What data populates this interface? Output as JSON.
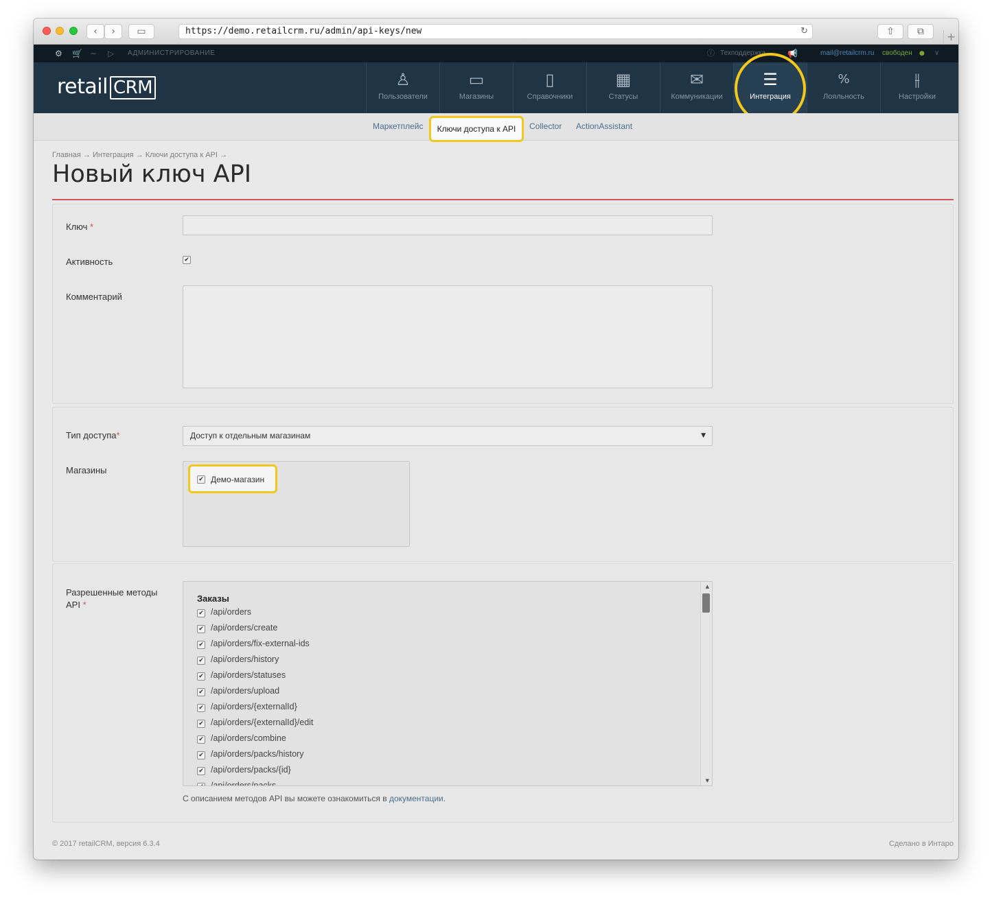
{
  "browser": {
    "url": "https://demo.retailcrm.ru/admin/api-keys/new",
    "new_tab": "+"
  },
  "adminbar": {
    "section": "АДМИНИСТРИРОВАНИЕ",
    "support": "Техподдержка",
    "email": "mail@retailcrm.ru",
    "status": "свободен"
  },
  "header": {
    "logo_text": "retail",
    "logo_crm": "CRM",
    "nav": [
      {
        "label": "Пользователи",
        "icon": "user-icon"
      },
      {
        "label": "Магазины",
        "icon": "shop-icon"
      },
      {
        "label": "Справочники",
        "icon": "document-icon"
      },
      {
        "label": "Статусы",
        "icon": "statuses-icon"
      },
      {
        "label": "Коммуникации",
        "icon": "mail-icon"
      },
      {
        "label": "Интеграция",
        "icon": "integration-icon",
        "active": true
      },
      {
        "label": "Лояльность",
        "icon": "discount-icon"
      },
      {
        "label": "Настройки",
        "icon": "sliders-icon"
      }
    ]
  },
  "subnav": {
    "items": [
      "Маркетплейс",
      "Ключи доступа к API",
      "Collector",
      "ActionAssistant"
    ],
    "active": "Ключи доступа к API"
  },
  "breadcrumb": "Главная → Интеграция → Ключи доступа к API →",
  "page_title": "Новый ключ API",
  "form": {
    "key_label": "Ключ",
    "key_value": "",
    "active_label": "Активность",
    "active_checked": true,
    "comment_label": "Комментарий",
    "comment_value": "",
    "access_type_label": "Тип доступа",
    "access_type_value": "Доступ к отдельным магазинам",
    "shops_label": "Магазины",
    "shops": [
      {
        "name": "Демо-магазин",
        "checked": true
      }
    ],
    "methods_label": "Разрешенные методы API",
    "methods_group": "Заказы",
    "methods": [
      "/api/orders",
      "/api/orders/create",
      "/api/orders/fix-external-ids",
      "/api/orders/history",
      "/api/orders/statuses",
      "/api/orders/upload",
      "/api/orders/{externalId}",
      "/api/orders/{externalId}/edit",
      "/api/orders/combine",
      "/api/orders/packs/history",
      "/api/orders/packs/{id}",
      "/api/orders/packs"
    ],
    "doc_note": "С описанием методов API вы можете ознакомиться в",
    "doc_link": "документации",
    "required_mark": "*"
  },
  "footer": {
    "copyright": "© 2017 retailCRM, версия 6.3.4",
    "made_by": "Сделано в Интаро"
  },
  "colors": {
    "header_bg": "#1f3445",
    "highlight": "#f2c81b",
    "accent_red": "#d0545c",
    "link": "#4a6e8e"
  }
}
